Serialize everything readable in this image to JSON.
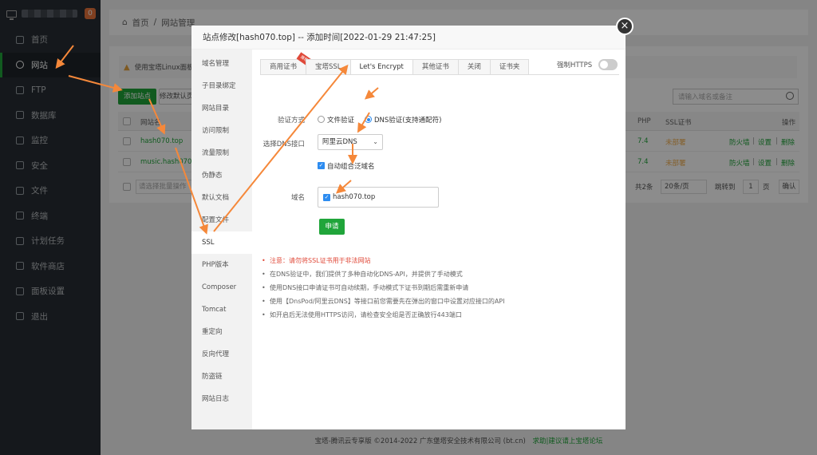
{
  "sidebar": {
    "badge": "0",
    "items": [
      {
        "label": "首页"
      },
      {
        "label": "网站"
      },
      {
        "label": "FTP"
      },
      {
        "label": "数据库"
      },
      {
        "label": "监控"
      },
      {
        "label": "安全"
      },
      {
        "label": "文件"
      },
      {
        "label": "终端"
      },
      {
        "label": "计划任务"
      },
      {
        "label": "软件商店"
      },
      {
        "label": "面板设置"
      },
      {
        "label": "退出"
      }
    ]
  },
  "breadcrumb": {
    "home": "首页",
    "sep": "/",
    "current": "网站管理"
  },
  "background": {
    "warning": "使用宝塔Linux面板",
    "add_site": "添加站点",
    "default_page": "修改默认页",
    "search_placeholder": "请输入域名或备注",
    "headers": {
      "name": "网站名",
      "php": "PHP",
      "ssl": "SSL证书",
      "ops": "操作"
    },
    "rows": [
      {
        "name": "hash070.top",
        "php": "7.4",
        "ssl": "未部署",
        "firewall": "防火墙",
        "settings": "设置",
        "delete": "删除"
      },
      {
        "name": "music.hash070.t",
        "php": "7.4",
        "ssl": "未部署",
        "firewall": "防火墙",
        "settings": "设置",
        "delete": "删除"
      }
    ],
    "batch_placeholder": "请选择批量操作",
    "total": "共2条",
    "per_page": "20条/页",
    "jump": "跳转到",
    "page_num": "1",
    "page_unit": "页",
    "confirm": "确认"
  },
  "footer": {
    "text": "宝塔-腾讯云专享版 ©2014-2022 广东堡塔安全技术有限公司 (bt.cn)",
    "link": "求助|建议请上宝塔论坛"
  },
  "modal": {
    "title": "站点修改[hash070.top] -- 添加时间[2022-01-29 21:47:25]",
    "close": "×",
    "menu": [
      "域名管理",
      "子目录绑定",
      "网站目录",
      "访问限制",
      "流量限制",
      "伪静态",
      "默认文档",
      "配置文件",
      "SSL",
      "PHP版本",
      "Composer",
      "Tomcat",
      "重定向",
      "反向代理",
      "防盗链",
      "网站日志"
    ],
    "tabs": [
      "商用证书",
      "宝塔SSL",
      "Let's Encrypt",
      "其他证书",
      "关闭",
      "证书夹"
    ],
    "ribbon": "推荐",
    "force_https": "强制HTTPS",
    "verify_label": "验证方式",
    "verify_file": "文件验证",
    "verify_dns": "DNS验证(支持通配符)",
    "dns_label": "选择DNS接口",
    "dns_value": "阿里云DNS",
    "auto_combine": "自动组合泛域名",
    "domain_label": "域名",
    "domain_value": "hash070.top",
    "apply": "申请",
    "notes": [
      "注意：请勿将SSL证书用于非法网站",
      "在DNS验证中，我们提供了多种自动化DNS-API，并提供了手动模式",
      "使用DNS接口申请证书可自动续期，手动模式下证书到期后需重新申请",
      "使用【DnsPod/阿里云DNS】等接口前您需要先在弹出的窗口中设置对应接口的API",
      "如开启后无法使用HTTPS访问，请检查安全组是否正确放行443端口"
    ]
  },
  "colors": {
    "accent": "#20a53a",
    "sidebar": "#272d33",
    "arrow": "#f5883a",
    "warning": "#e04a3a"
  }
}
